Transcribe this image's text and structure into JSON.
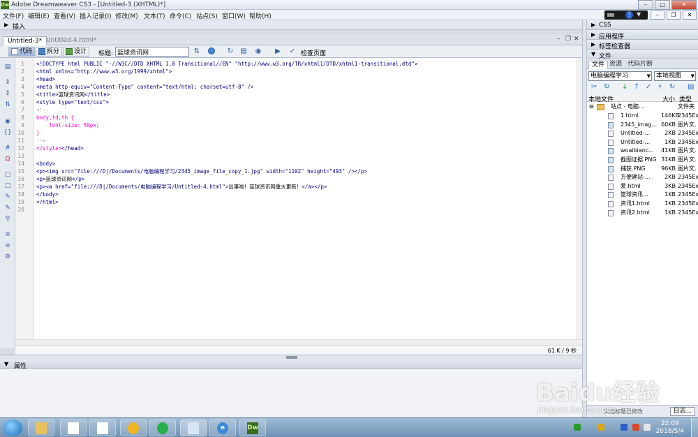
{
  "app": {
    "logo": "Dw",
    "title": "Adobe Dreamweaver CS3 - [Untitled-3 (XHTML)*]"
  },
  "menu": [
    "文件(F)",
    "编辑(E)",
    "查看(V)",
    "插入记录(I)",
    "修改(M)",
    "文本(T)",
    "命令(C)",
    "站点(S)",
    "窗口(W)",
    "帮助(H)"
  ],
  "insert_bar": {
    "label": "插入"
  },
  "tabs": [
    {
      "label": "Untitled-3*",
      "active": true
    },
    {
      "label": "Untitled-4.html*",
      "active": false
    }
  ],
  "doc_toolbar": {
    "code": "代码",
    "split": "拆分",
    "design": "设计",
    "title_label": "标题:",
    "title_value": "篮球资讯网",
    "check_page": "检查页面"
  },
  "line_numbers": [
    "1",
    "2",
    "3",
    "4",
    "5",
    "6",
    "7",
    "8",
    "9",
    "10",
    "11",
    "12",
    "13",
    "14",
    "15",
    "16",
    "17",
    "18",
    "19",
    "20"
  ],
  "code_lines": [
    [
      [
        "tag",
        "<!DOCTYPE html PUBLIC \"-//W3C//DTD XHTML 1.0 Transitional//EN\" \"http://www.w3.org/TR/xhtml1/DTD/xhtml1-transitional.dtd\">"
      ]
    ],
    [
      [
        "tag",
        "<html xmlns=\"http://www.w3.org/1999/xhtml\">"
      ]
    ],
    [
      [
        "tag",
        "<head>"
      ]
    ],
    [
      [
        "tag",
        "<meta http-equiv=\"Content-Type\" content=\"text/html; charset=utf-8\" />"
      ]
    ],
    [
      [
        "tag",
        "<title>"
      ],
      [
        "txt",
        "篮球资讯网"
      ],
      [
        "tag",
        "</title>"
      ]
    ],
    [
      [
        "tag",
        "<style type=\"text/css\">"
      ]
    ],
    [
      [
        "cmt",
        "<!--"
      ]
    ],
    [
      [
        "css",
        "body,td,th {"
      ]
    ],
    [
      [
        "css",
        "    font-size: 50px;"
      ]
    ],
    [
      [
        "css",
        "}"
      ]
    ],
    [
      [
        "cmt",
        "-->"
      ]
    ],
    [
      [
        "css",
        "</style>"
      ],
      [
        "tag",
        "</head>"
      ]
    ],
    [],
    [
      [
        "tag",
        "<body>"
      ]
    ],
    [
      [
        "tag",
        "<p><img src=\"file:///D|/Documents/电脑编程学习/2345_image_file_copy_1.jpg\" width=\"1102\" height=\"493\" /></p>"
      ]
    ],
    [
      [
        "tag",
        "<p>"
      ],
      [
        "txt",
        "篮球资讯网"
      ],
      [
        "tag",
        "</p>"
      ]
    ],
    [
      [
        "tag",
        "<p><a href=\"file:///D|/Documents/电脑编程学习/Untitled-4.html\">"
      ],
      [
        "txt",
        "出事啦！篮球资讯网重大更新！"
      ],
      [
        "tag",
        "</a></p>"
      ]
    ],
    [
      [
        "tag",
        "</body>"
      ]
    ],
    [
      [
        "tag",
        "</html>"
      ]
    ],
    []
  ],
  "status": {
    "size": "61 K / 9 秒"
  },
  "properties": {
    "label": "属性"
  },
  "right_panels": {
    "css": "CSS",
    "app": "应用程序",
    "tag_inspector": "标签检查器",
    "files": "文件"
  },
  "files_tabs": [
    "文件",
    "资源",
    "代码片断"
  ],
  "files_panel": {
    "site": "电脑编程学习",
    "view": "本地视图",
    "columns": {
      "name": "本地文件",
      "size": "大小",
      "type": "类型"
    },
    "root": {
      "name": "站点 - 电脑...",
      "type": "文件夹"
    },
    "files": [
      {
        "name": "1.html",
        "size": "146KB",
        "type": "2345Ex.",
        "kind": "doc"
      },
      {
        "name": "2345_imag...",
        "size": "60KB",
        "type": "图片文.",
        "kind": "img"
      },
      {
        "name": "Untitled-...",
        "size": "2KB",
        "type": "2345Ex.",
        "kind": "doc"
      },
      {
        "name": "Untitled-...",
        "size": "1KB",
        "type": "2345Ex.",
        "kind": "doc"
      },
      {
        "name": "woaibianc...",
        "size": "41KB",
        "type": "图片文.",
        "kind": "img"
      },
      {
        "name": "截图证据.PNG",
        "size": "31KB",
        "type": "图片文.",
        "kind": "img"
      },
      {
        "name": "捕获.PNG",
        "size": "96KB",
        "type": "图片文.",
        "kind": "img"
      },
      {
        "name": "方便建站-...",
        "size": "2KB",
        "type": "2345Ex.",
        "kind": "doc"
      },
      {
        "name": "爱.html",
        "size": "3KB",
        "type": "2345Ex.",
        "kind": "doc"
      },
      {
        "name": "篮球资讯...",
        "size": "1KB",
        "type": "2345Ex.",
        "kind": "doc"
      },
      {
        "name": "资讯1.html",
        "size": "1KB",
        "type": "2345Ex.",
        "kind": "doc"
      },
      {
        "name": "资讯2.html",
        "size": "1KB",
        "type": "2345Ex.",
        "kind": "doc"
      }
    ],
    "status_text": "文档标题已修改",
    "log_label": "日志..."
  },
  "taskbar": {
    "time": "22:09",
    "date": "2018/5/4",
    "dw_label": "Dw"
  },
  "watermark": {
    "main": "Baidu经验",
    "sub": "jingyan.baidu.com"
  }
}
